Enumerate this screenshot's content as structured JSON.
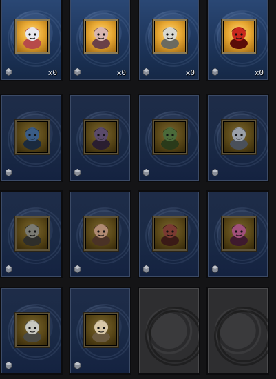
{
  "cards": [
    {
      "id": "silver-hair-girl",
      "count": "x0",
      "state": "owned",
      "icon": "silver-hair-girl-icon",
      "colors": {
        "a": "#e8e8ee",
        "b": "#b74a4a"
      }
    },
    {
      "id": "bone-spider",
      "count": "x0",
      "state": "owned",
      "icon": "bone-spider-icon",
      "colors": {
        "a": "#d8b6b0",
        "b": "#6a4048"
      }
    },
    {
      "id": "pale-knight",
      "count": "x0",
      "state": "owned",
      "icon": "pale-knight-icon",
      "colors": {
        "a": "#d8d8d0",
        "b": "#6a6a60"
      }
    },
    {
      "id": "red-demon",
      "count": "x0",
      "state": "owned",
      "icon": "red-demon-icon",
      "colors": {
        "a": "#c8281e",
        "b": "#5a0c08"
      }
    },
    {
      "id": "blue-dragon",
      "count": "",
      "state": "locked",
      "icon": "blue-dragon-icon",
      "colors": {
        "a": "#3a5c86",
        "b": "#1a2a3e"
      }
    },
    {
      "id": "pirate-captain",
      "count": "",
      "state": "locked",
      "icon": "pirate-captain-icon",
      "colors": {
        "a": "#5a4a6a",
        "b": "#2a1e30"
      }
    },
    {
      "id": "green-lizard",
      "count": "",
      "state": "locked",
      "icon": "green-lizard-icon",
      "colors": {
        "a": "#4a6a3a",
        "b": "#2a3a1a"
      }
    },
    {
      "id": "grey-wraith",
      "count": "",
      "state": "locked",
      "icon": "grey-wraith-icon",
      "colors": {
        "a": "#9aa0aa",
        "b": "#4a505a"
      }
    },
    {
      "id": "stone-golem",
      "count": "",
      "state": "locked",
      "icon": "stone-golem-icon",
      "colors": {
        "a": "#7a7a72",
        "b": "#2e2e2a"
      }
    },
    {
      "id": "tribal-warrior",
      "count": "",
      "state": "locked",
      "icon": "tribal-warrior-icon",
      "colors": {
        "a": "#b08a72",
        "b": "#4a3226"
      }
    },
    {
      "id": "hooded-brute",
      "count": "",
      "state": "locked",
      "icon": "hooded-brute-icon",
      "colors": {
        "a": "#7a3a32",
        "b": "#3a1a16"
      }
    },
    {
      "id": "purple-sorceress",
      "count": "",
      "state": "locked",
      "icon": "purple-sorceress-icon",
      "colors": {
        "a": "#a0507a",
        "b": "#3e1a2e"
      }
    },
    {
      "id": "pale-ghoul",
      "count": "",
      "state": "locked",
      "icon": "pale-ghoul-icon",
      "colors": {
        "a": "#c8c8c0",
        "b": "#4a4a44"
      }
    },
    {
      "id": "bone-crab",
      "count": "",
      "state": "locked",
      "icon": "bone-crab-icon",
      "colors": {
        "a": "#d8c8a8",
        "b": "#6a5a40"
      }
    },
    {
      "id": "empty-slot-1",
      "count": "",
      "state": "empty"
    },
    {
      "id": "empty-slot-2",
      "count": "",
      "state": "empty"
    }
  ]
}
